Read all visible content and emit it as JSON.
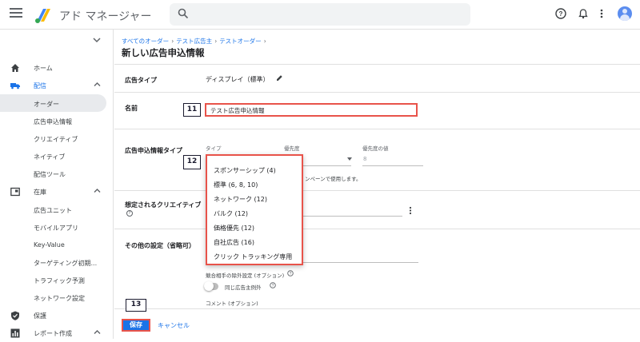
{
  "app": {
    "title": "アド マネージャー"
  },
  "search": {
    "placeholder": ""
  },
  "sidebar": {
    "items": [
      {
        "label": "ホーム"
      },
      {
        "label": "配信"
      },
      {
        "label": "在庫"
      },
      {
        "label": "保護"
      },
      {
        "label": "レポート作成"
      }
    ],
    "delivery_sub": [
      "オーダー",
      "広告申込情報",
      "クリエイティブ",
      "ネイティブ",
      "配信ツール"
    ],
    "inventory_sub": [
      "広告ユニット",
      "モバイルアプリ",
      "Key-Value",
      "ターゲティング初期...",
      "トラフィック予測",
      "ネットワーク設定"
    ]
  },
  "breadcrumb": [
    "すべてのオーダー",
    "テスト広告主",
    "テストオーダー"
  ],
  "page": {
    "title": "新しい広告申込情報"
  },
  "form": {
    "ad_type_label": "広告タイプ",
    "ad_type_value": "ディスプレイ（標準）",
    "name_label": "名前",
    "name_value": "テスト広告申込情報",
    "line_item_type_label": "広告申込情報タイプ",
    "type_caption": "タイプ",
    "priority_caption": "優先度",
    "priority_value_caption": "優先度の値",
    "priority_value": "8",
    "campaign_hint": "ンペーンで使用します。",
    "expected_creative_label": "想定されるクリエイティブ",
    "other_settings_label": "その他の設定（省略可）",
    "competitive_exclusion": "競合相手の除外設定 (オプション)",
    "same_advertiser_exception": "同じ広告主例外",
    "comment_caption": "コメント (オプション)"
  },
  "dropdown": {
    "options": [
      "スポンサーシップ (4)",
      "標準 (6, 8, 10)",
      "ネットワーク (12)",
      "バルク (12)",
      "価格優先 (12)",
      "自社広告 (16)",
      "クリック トラッキング専用"
    ]
  },
  "markers": {
    "name": "11",
    "dropdown": "12",
    "save": "13"
  },
  "footer": {
    "save_label": "保存",
    "cancel_label": "キャンセル"
  },
  "colors": {
    "accent": "#1a73e8",
    "highlight": "#e8534a"
  }
}
